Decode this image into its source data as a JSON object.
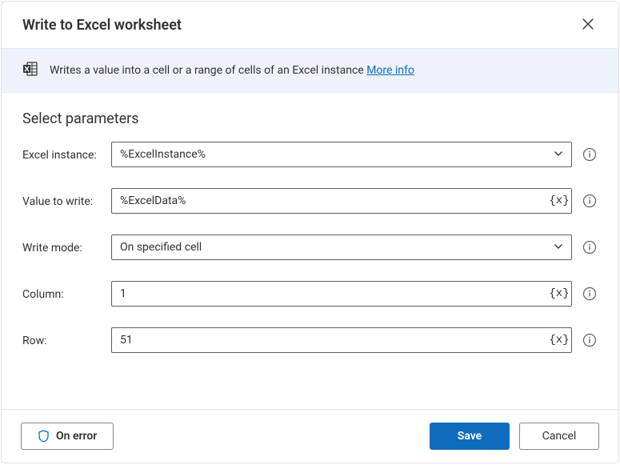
{
  "header": {
    "title": "Write to Excel worksheet"
  },
  "info": {
    "text": "Writes a value into a cell or a range of cells of an Excel instance ",
    "link_label": "More info"
  },
  "section": {
    "title": "Select parameters"
  },
  "fields": {
    "excel_instance": {
      "label": "Excel instance:",
      "value": "%ExcelInstance%"
    },
    "value_to_write": {
      "label": "Value to write:",
      "value": "%ExcelData%"
    },
    "write_mode": {
      "label": "Write mode:",
      "value": "On specified cell"
    },
    "column": {
      "label": "Column:",
      "value": "1"
    },
    "row": {
      "label": "Row:",
      "value": "51"
    }
  },
  "var_token": "{x}",
  "footer": {
    "on_error_label": "On error",
    "save_label": "Save",
    "cancel_label": "Cancel"
  }
}
